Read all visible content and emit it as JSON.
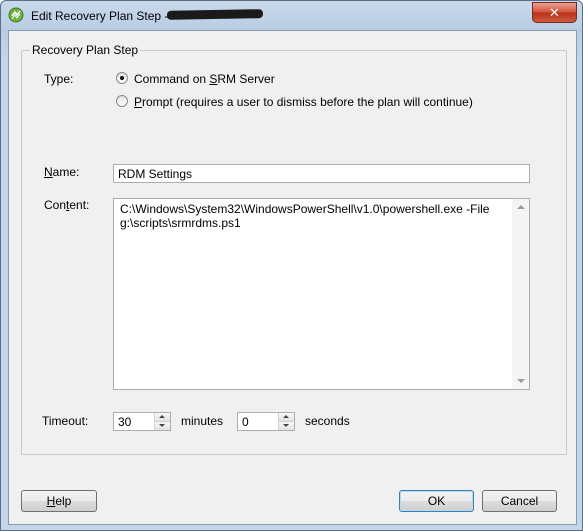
{
  "window": {
    "title": "Edit Recovery Plan Step - ",
    "close_label": "✕"
  },
  "group": {
    "label": "Recovery Plan Step"
  },
  "type": {
    "label": "Type:",
    "options": [
      {
        "pre": "Command on ",
        "ul": "S",
        "post": "RM Server",
        "checked": true
      },
      {
        "pre": "",
        "ul": "P",
        "post": "rompt (requires a user to dismiss before the plan will continue)",
        "checked": false
      }
    ]
  },
  "name": {
    "label_ul": "N",
    "label_rest": "ame:",
    "value": "RDM Settings"
  },
  "content": {
    "label_pre": "Con",
    "label_ul": "t",
    "label_post": "ent:",
    "value": "C:\\Windows\\System32\\WindowsPowerShell\\v1.0\\powershell.exe -File g:\\scripts\\srmrdms.ps1"
  },
  "timeout": {
    "label": "Timeout:",
    "minutes_value": "30",
    "minutes_label": "minutes",
    "seconds_value": "0",
    "seconds_label": "seconds"
  },
  "buttons": {
    "help_ul": "H",
    "help_rest": "elp",
    "ok": "OK",
    "cancel": "Cancel"
  }
}
